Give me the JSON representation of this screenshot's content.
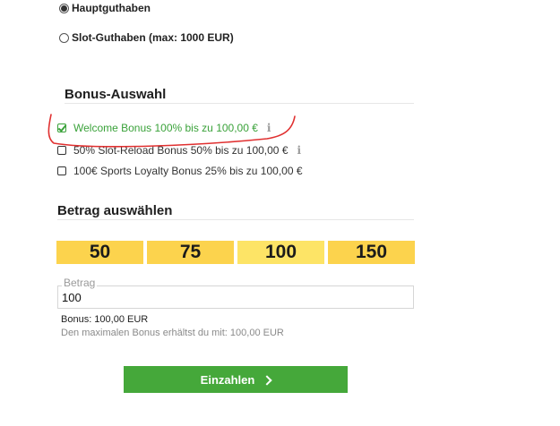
{
  "balance": {
    "options": [
      {
        "label": "Hauptguthaben",
        "selected": true
      },
      {
        "label": "Slot-Guthaben (max: 1000 EUR)",
        "selected": false
      }
    ]
  },
  "bonus": {
    "title": "Bonus-Auswahl",
    "items": [
      {
        "label": "Welcome Bonus 100% bis zu 100,00 €",
        "checked": true,
        "info": "i"
      },
      {
        "label": "50% Slot-Reload Bonus 50% bis zu 100,00 €",
        "checked": false,
        "info": "i"
      },
      {
        "label": "100€ Sports Loyalty Bonus 25% bis zu 100,00 €",
        "checked": false
      }
    ]
  },
  "amount": {
    "title": "Betrag auswählen",
    "presets": [
      "50",
      "75",
      "100",
      "150"
    ],
    "selected_preset": "100",
    "field_label": "Betrag",
    "field_value": "100",
    "bonus_text": "Bonus: 100,00 EUR",
    "max_bonus_text": "Den maximalen Bonus erhältst du mit: 100,00 EUR"
  },
  "submit": {
    "label": "Einzahlen"
  },
  "colors": {
    "preset_bg": "#fcd34d",
    "primary_green": "#45a83a",
    "active_green": "#3aa23a",
    "annotation_red": "#e03030"
  },
  "icons": {
    "info": "info-icon",
    "chevron": "chevron-right-icon",
    "checkmark": "checkmark-icon"
  }
}
